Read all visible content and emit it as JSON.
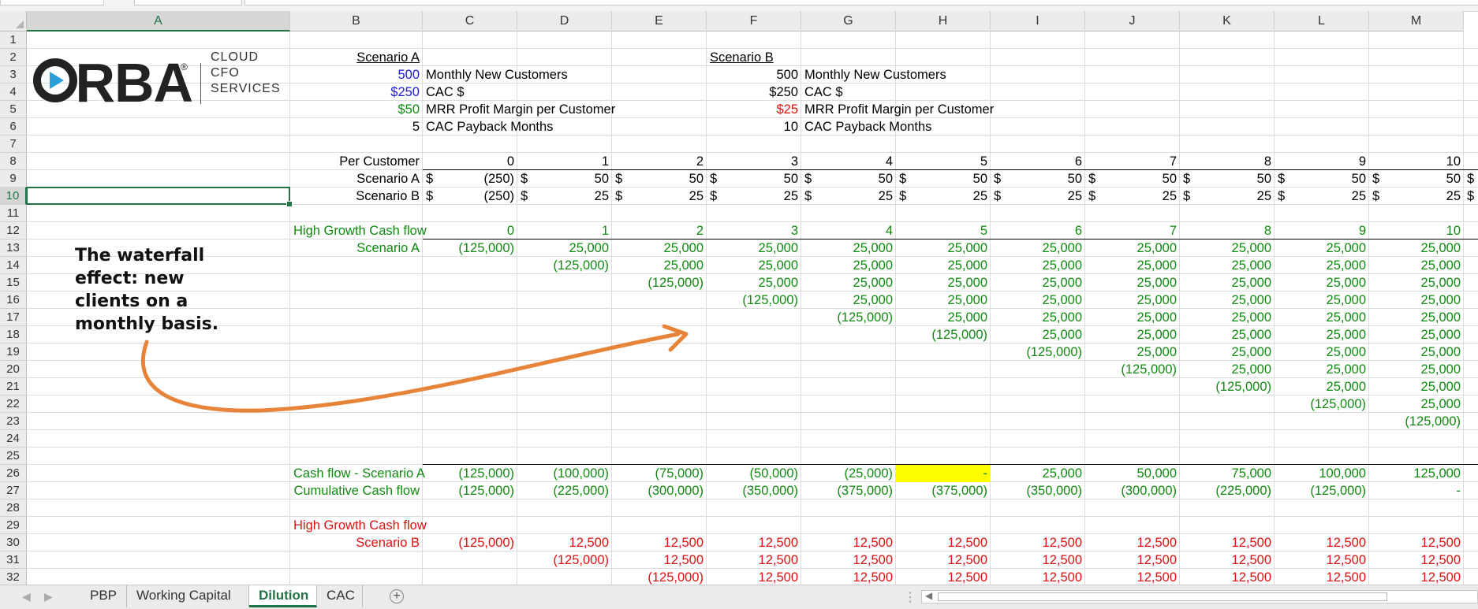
{
  "columns": [
    "A",
    "B",
    "C",
    "D",
    "E",
    "F",
    "G",
    "H",
    "I",
    "J",
    "K",
    "L",
    "M"
  ],
  "selected_cell": {
    "col": "A",
    "row": 10
  },
  "logo": {
    "brand": "ORBA",
    "reg": "®",
    "lines": [
      "CLOUD",
      "CFO",
      "SERVICES"
    ]
  },
  "scenario_a": {
    "title": "Scenario A",
    "new_customers": "500",
    "new_customers_label": "Monthly New Customers",
    "cac": "$250",
    "cac_label": "CAC $",
    "margin": "$50",
    "margin_label": "MRR Profit Margin per Customer",
    "payback": "5",
    "payback_label": "CAC Payback Months"
  },
  "scenario_b": {
    "title": "Scenario B",
    "new_customers": "500",
    "new_customers_label": "Monthly New Customers",
    "cac": "$250",
    "cac_label": "CAC $",
    "margin": "$25",
    "margin_label": "MRR Profit Margin per Customer",
    "payback": "10",
    "payback_label": "CAC Payback Months"
  },
  "per_customer": {
    "label": "Per Customer",
    "months": [
      "0",
      "1",
      "2",
      "3",
      "4",
      "5",
      "6",
      "7",
      "8",
      "9",
      "10"
    ],
    "scenario_a_label": "Scenario A",
    "scenario_a": [
      "(250)",
      "50",
      "50",
      "50",
      "50",
      "50",
      "50",
      "50",
      "50",
      "50",
      "50"
    ],
    "scenario_b_label": "Scenario B",
    "scenario_b": [
      "(250)",
      "25",
      "25",
      "25",
      "25",
      "25",
      "25",
      "25",
      "25",
      "25",
      "25"
    ],
    "currency": "$"
  },
  "high_growth_a": {
    "label": "High Growth Cash flow",
    "sub_label": "Scenario A",
    "months": [
      "0",
      "1",
      "2",
      "3",
      "4",
      "5",
      "6",
      "7",
      "8",
      "9",
      "10"
    ]
  },
  "waterfall_values": {
    "cost": "(125,000)",
    "profit_a": "25,000",
    "profit_b": "12,500",
    "zero": "-"
  },
  "cash_flow": {
    "a_label": "Cash flow - Scenario A",
    "a": [
      "(125,000)",
      "(100,000)",
      "(75,000)",
      "(50,000)",
      "(25,000)",
      "-",
      "25,000",
      "50,000",
      "75,000",
      "100,000",
      "125,000"
    ],
    "cum_label": "Cumulative Cash flow",
    "cum": [
      "(125,000)",
      "(225,000)",
      "(300,000)",
      "(350,000)",
      "(375,000)",
      "(375,000)",
      "(350,000)",
      "(300,000)",
      "(225,000)",
      "(125,000)",
      "-"
    ]
  },
  "high_growth_b": {
    "label": "High Growth Cash flow",
    "sub_label": "Scenario B"
  },
  "annotation": "The waterfall effect: new clients on a monthly basis.",
  "colors": {
    "green": "#108a10",
    "blue": "#1a1ad6",
    "red": "#e01010",
    "highlight": "#ffff00",
    "arrow": "#e8843a",
    "excel_green": "#217346"
  },
  "sheet_tabs": [
    {
      "label": "PBP",
      "active": false
    },
    {
      "label": "Working Capital",
      "active": false
    },
    {
      "label": "Dilution",
      "active": true
    },
    {
      "label": "CAC",
      "active": false
    }
  ]
}
